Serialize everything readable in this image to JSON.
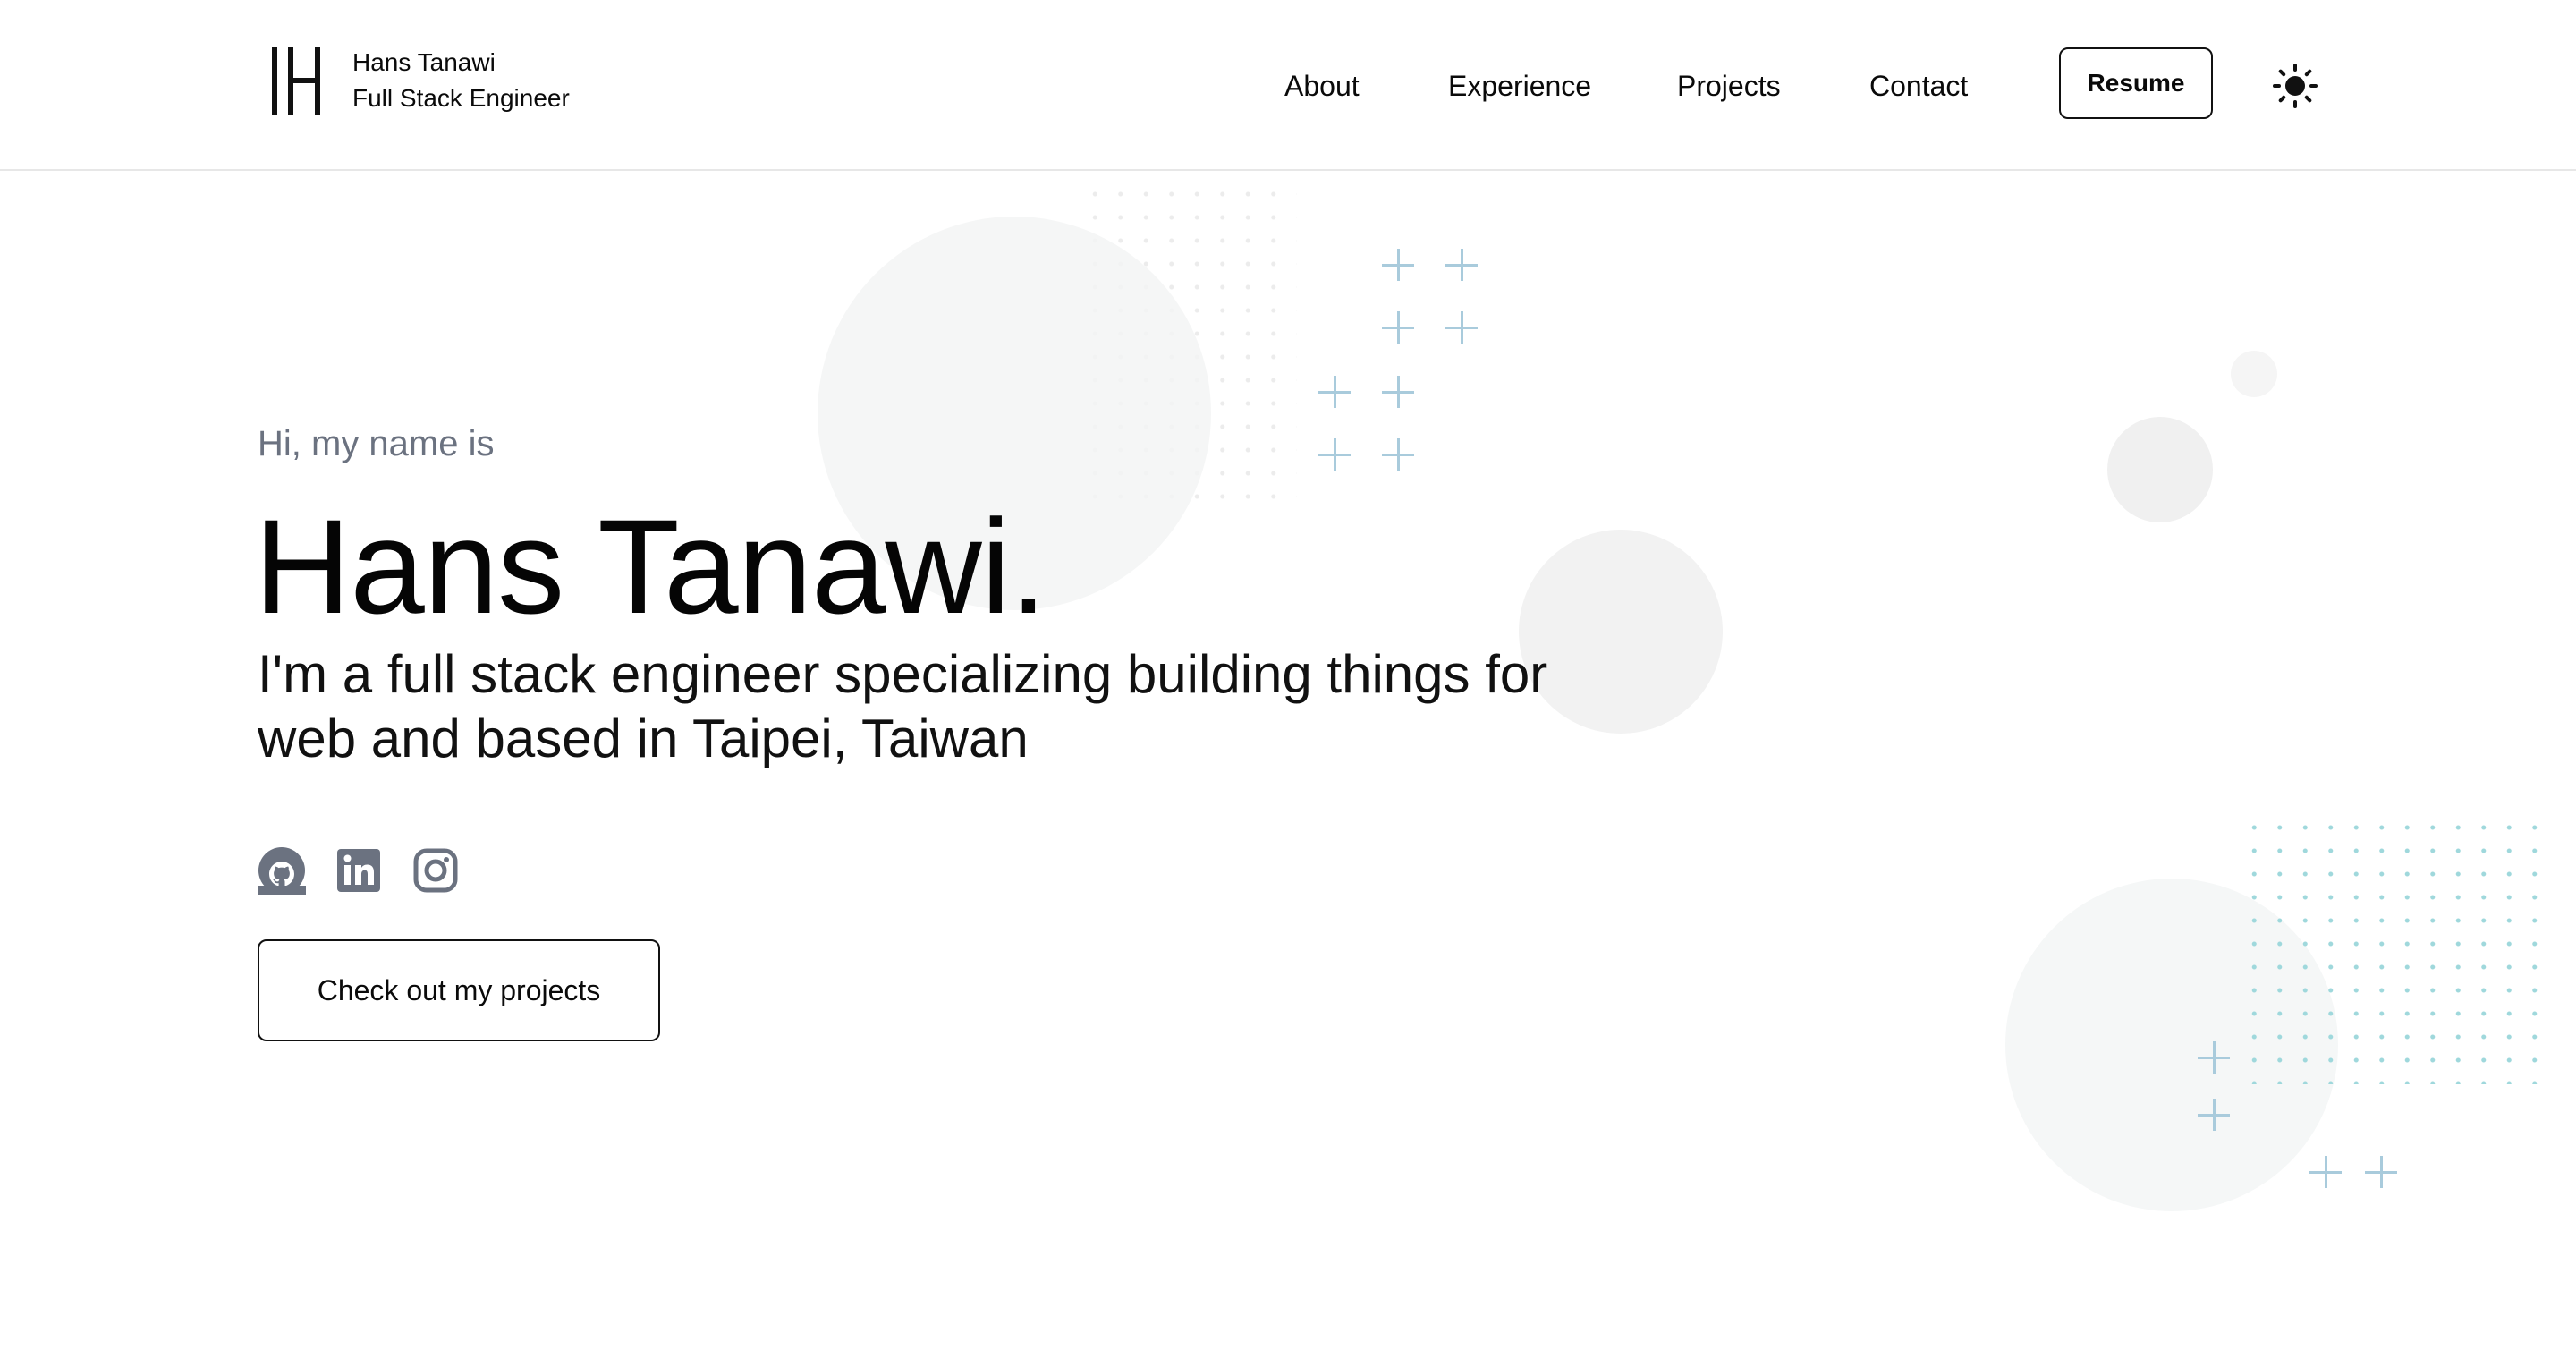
{
  "header": {
    "brand": {
      "name": "Hans Tanawi",
      "role": "Full Stack Engineer"
    },
    "nav": [
      {
        "label": "About"
      },
      {
        "label": "Experience"
      },
      {
        "label": "Projects"
      },
      {
        "label": "Contact"
      }
    ],
    "resume_label": "Resume",
    "theme_icon": "sun-icon"
  },
  "hero": {
    "greeting": "Hi, my name is",
    "name": "Hans Tanawi.",
    "tagline": "I'm a full stack engineer specializing building things for web and based in Taipei, Taiwan",
    "socials": [
      {
        "icon": "github-icon"
      },
      {
        "icon": "linkedin-icon"
      },
      {
        "icon": "instagram-icon"
      }
    ],
    "cta_label": "Check out my projects"
  },
  "colors": {
    "text": "#0a0a0a",
    "muted": "#6b7280",
    "accent_plus": "#a9cbdc",
    "dot_teal": "#8fd1d6",
    "circle_gray": "#f2f2f2",
    "header_border": "#e7e7e7"
  }
}
